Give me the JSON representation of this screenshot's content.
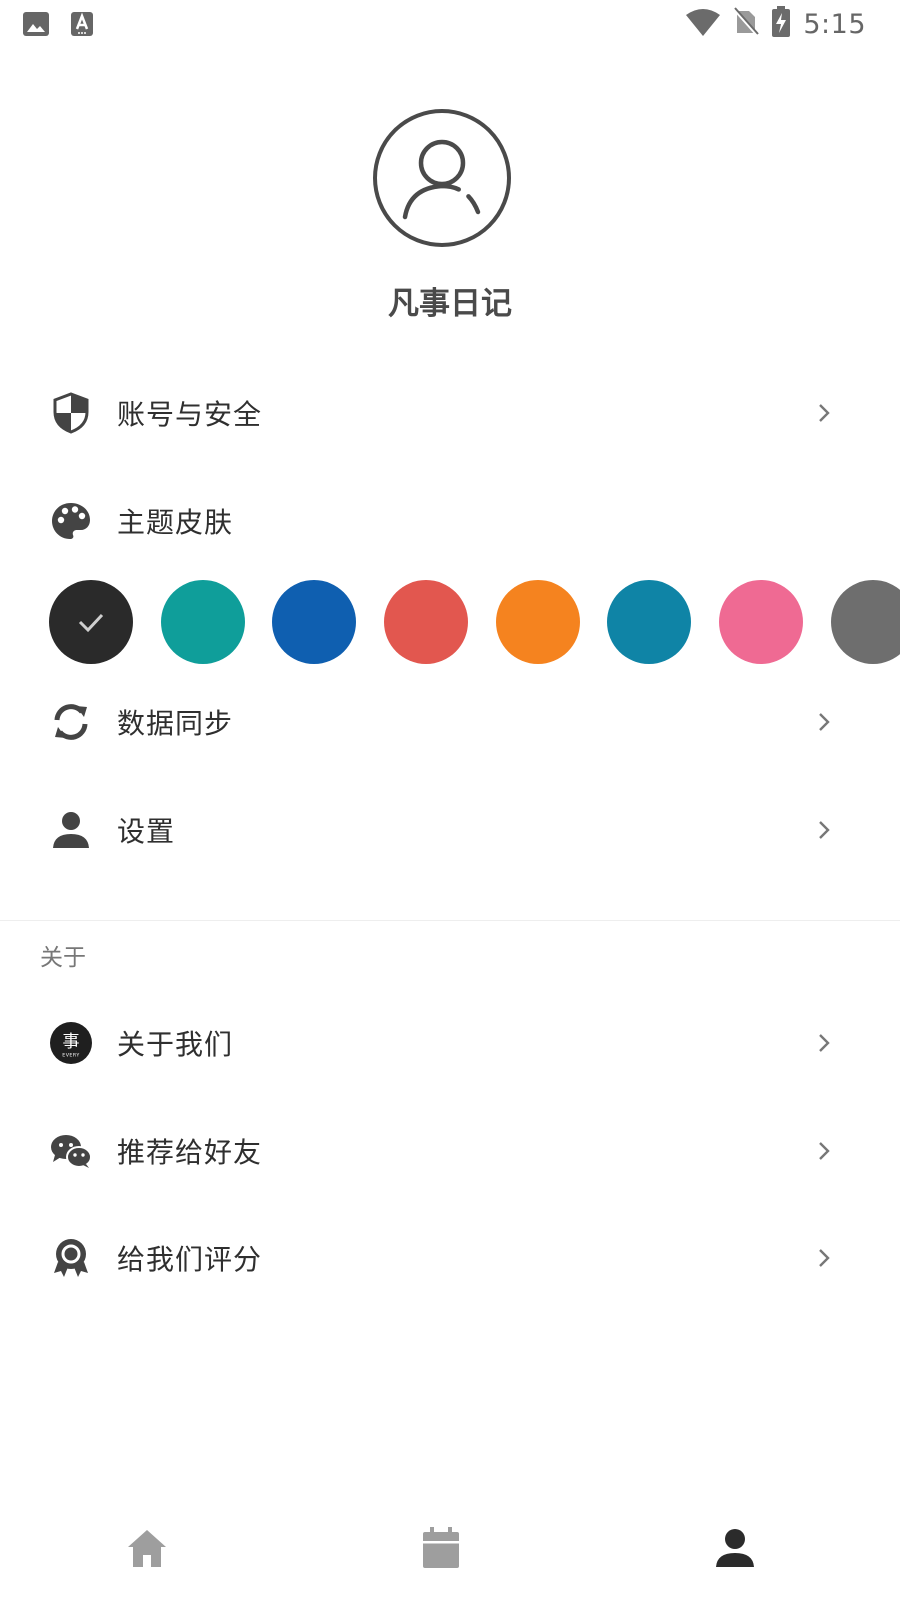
{
  "status_bar": {
    "time": "5:15",
    "left_icons": [
      "image-icon",
      "keyboard-a-icon"
    ],
    "right_icons": [
      "wifi-icon",
      "no-sim-icon",
      "battery-charging-icon"
    ]
  },
  "profile": {
    "avatar_icon": "user-outline-icon",
    "app_name": "凡事日记"
  },
  "menu": {
    "account": {
      "label": "账号与安全",
      "icon": "shield-icon"
    },
    "theme": {
      "label": "主题皮肤",
      "icon": "palette-icon"
    },
    "sync": {
      "label": "数据同步",
      "icon": "sync-icon"
    },
    "settings": {
      "label": "设置",
      "icon": "person-icon"
    }
  },
  "theme_swatches": {
    "selected_index": 0,
    "colors": [
      "#2a2a2a",
      "#0f9e9a",
      "#0f5fb0",
      "#e2574f",
      "#f5831f",
      "#0f84a6",
      "#ef6a93",
      "#6e6e6e"
    ]
  },
  "about_section": {
    "title": "关于",
    "items": {
      "about_us": {
        "label": "关于我们",
        "icon": "every-logo-icon",
        "logo_text": "事",
        "logo_sub": "EVERY"
      },
      "recommend": {
        "label": "推荐给好友",
        "icon": "wechat-icon"
      },
      "rate": {
        "label": "给我们评分",
        "icon": "rating-badge-icon"
      }
    }
  },
  "bottom_nav": {
    "items": [
      "home-icon",
      "calendar-icon",
      "profile-icon"
    ],
    "active_index": 2
  }
}
